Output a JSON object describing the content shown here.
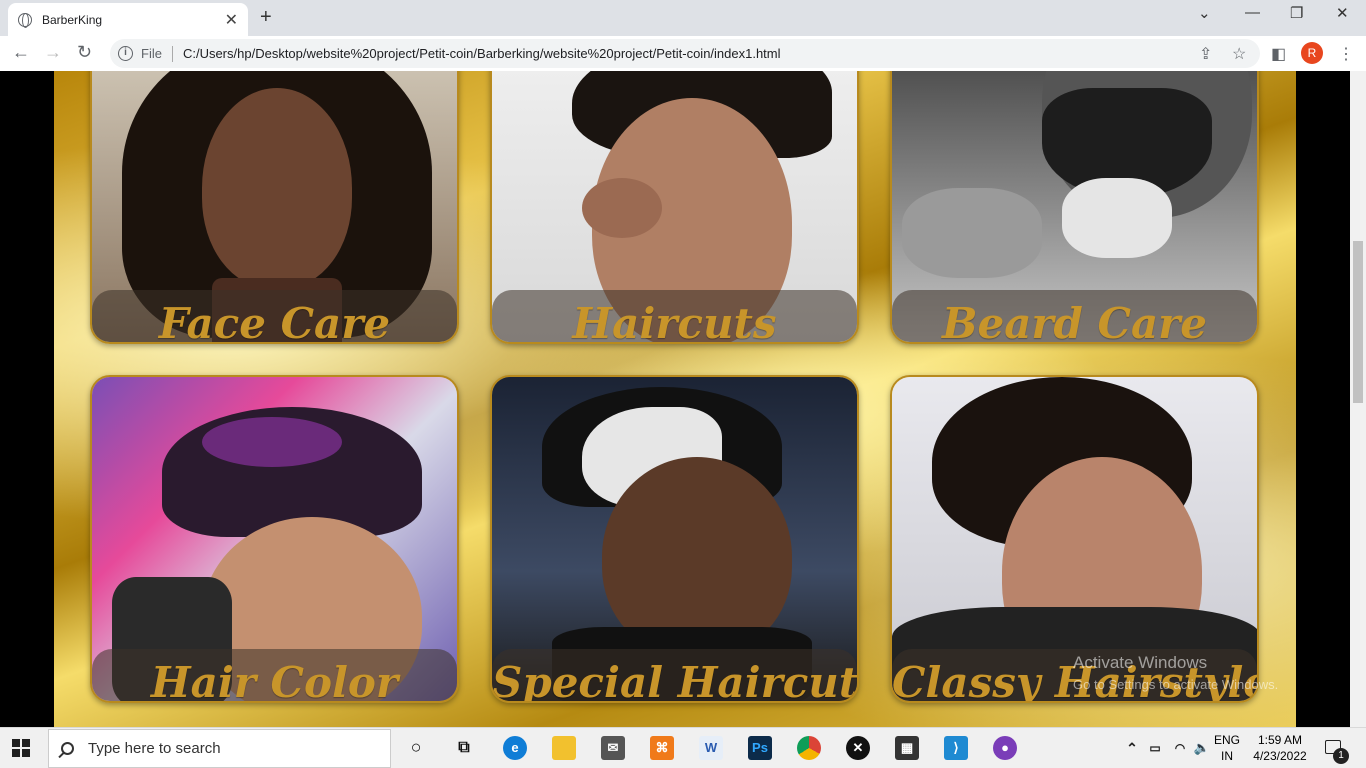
{
  "browser": {
    "tab_title": "BarberKing",
    "new_tab_glyph": "+",
    "address_label": "File",
    "url": "C:/Users/hp/Desktop/website%20project/Petit-coin/Barberking/website%20project/Petit-coin/index1.html",
    "profile_initial": "R"
  },
  "services": [
    {
      "label": "Face Care"
    },
    {
      "label": "Haircuts"
    },
    {
      "label": "Beard Care"
    },
    {
      "label": "Hair Color"
    },
    {
      "label": "Special Haircuts"
    },
    {
      "label": "Classy Hairstyle"
    }
  ],
  "watermark": {
    "line1": "Activate Windows",
    "line2": "Go to Settings to activate Windows."
  },
  "taskbar": {
    "search_placeholder": "Type here to search",
    "language_top": "ENG",
    "language_bottom": "IN",
    "time": "1:59 AM",
    "date": "4/23/2022",
    "notification_count": "1"
  },
  "colors": {
    "caption_gold": "#c8952a",
    "card_border": "#b88a1e"
  }
}
